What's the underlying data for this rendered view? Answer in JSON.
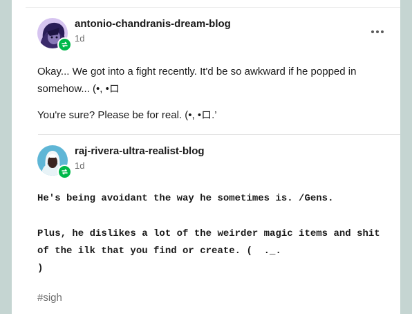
{
  "posts": [
    {
      "blog_name": "antonio-chandranis-dream-blog",
      "time": "1d",
      "paragraphs": [
        "Okay... We got into a fight recently. It'd be so awkward if he popped in somehow... (•, •ロ",
        "You're sure? Please be for real.  (•, •ロ.’"
      ],
      "avatar_icon": "purple-character-avatar",
      "badge_icon": "reblog-follow-icon",
      "menu_icon": "more-options-icon"
    },
    {
      "blog_name": "raj-rivera-ultra-realist-blog",
      "time": "1d",
      "paragraphs": [
        "He's being avoidant the way he sometimes is. /Gens.",
        "Plus, he dislikes a lot of the weirder magic items and shit of the ilk that you find or create. (  ._.\n)"
      ],
      "tags": [
        "#sigh"
      ],
      "avatar_icon": "teal-character-avatar",
      "badge_icon": "reblog-follow-icon"
    }
  ],
  "colors": {
    "background": "#c9d9d6",
    "card": "#ffffff",
    "follow_badge": "#00b84a",
    "text": "#1a1a1a",
    "muted": "#6e6e6e"
  }
}
